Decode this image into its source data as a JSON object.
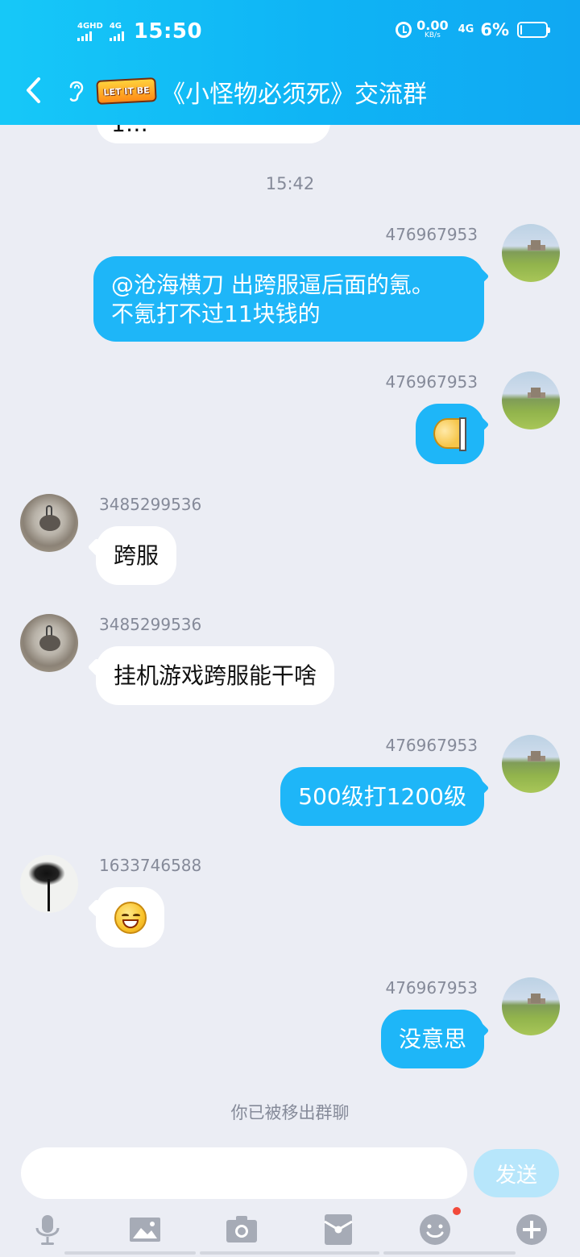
{
  "status_bar": {
    "sim1": "4GHD",
    "sim2": "4G",
    "time": "15:50",
    "speed_value": "0.00",
    "speed_unit": "KB/s",
    "network": "4G",
    "battery_percent": "6%",
    "battery_level": 0.06
  },
  "header": {
    "logo_text": "LET IT BE",
    "title": "《小怪物必须死》交流群"
  },
  "chat": {
    "partial_text": "1…",
    "timestamp": "15:42",
    "messages": [
      {
        "sender": "476967953",
        "lines": [
          "@沧海横刀 出跨服逼后面的氪。",
          "不氪打不过11块钱的"
        ]
      },
      {
        "sender": "476967953",
        "emoji": "half-face-emoji"
      },
      {
        "sender": "3485299536",
        "text": "跨服"
      },
      {
        "sender": "3485299536",
        "text": "挂机游戏跨服能干啥"
      },
      {
        "sender": "476967953",
        "text": "500级打1200级"
      },
      {
        "sender": "1633746588",
        "emoji": "grin-emoji"
      },
      {
        "sender": "476967953",
        "text": "没意思"
      }
    ],
    "system_message": "你已被移出群聊"
  },
  "input": {
    "placeholder": "",
    "send_label": "发送"
  },
  "toolbar": {
    "icons": [
      "microphone-icon",
      "image-icon",
      "camera-icon",
      "red-packet-icon",
      "emoji-icon",
      "plus-icon"
    ]
  },
  "colors": {
    "header_bg": "#10b4f5",
    "outgoing_bubble": "#1eb6f8",
    "incoming_bubble": "#ffffff",
    "chat_bg": "#ebedf4",
    "send_button": "#b7e6fb"
  }
}
